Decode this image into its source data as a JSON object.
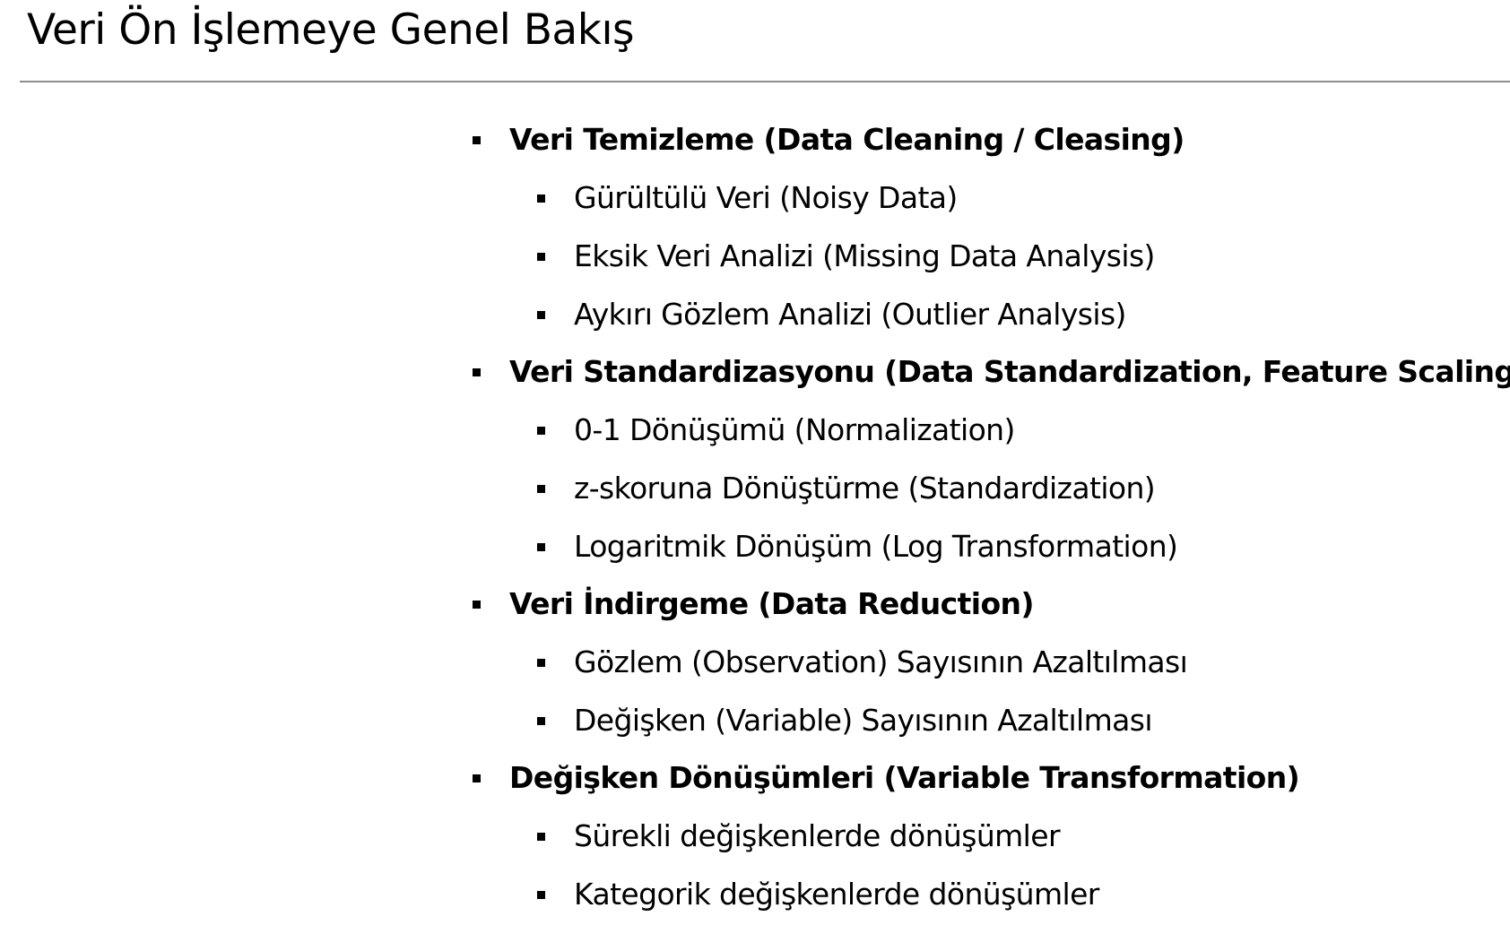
{
  "title": "Veri Ön İşlemeye Genel Bakış",
  "sections": [
    {
      "label": "Veri Temizleme (Data Cleaning / Cleasing)",
      "items": [
        "Gürültülü Veri (Noisy Data)",
        "Eksik Veri Analizi (Missing Data Analysis)",
        "Aykırı Gözlem Analizi (Outlier Analysis)"
      ]
    },
    {
      "label": "Veri Standardizasyonu (Data Standardization, Feature Scaling)",
      "items": [
        "0-1 Dönüşümü (Normalization)",
        "z-skoruna Dönüştürme (Standardization)",
        "Logaritmik Dönüşüm (Log Transformation)"
      ]
    },
    {
      "label": "Veri İndirgeme (Data Reduction)",
      "items": [
        "Gözlem (Observation) Sayısının Azaltılması",
        "Değişken (Variable) Sayısının Azaltılması"
      ]
    },
    {
      "label": "Değişken Dönüşümleri (Variable Transformation)",
      "items": [
        "Sürekli değişkenlerde dönüşümler",
        "Kategorik değişkenlerde dönüşümler"
      ]
    }
  ]
}
